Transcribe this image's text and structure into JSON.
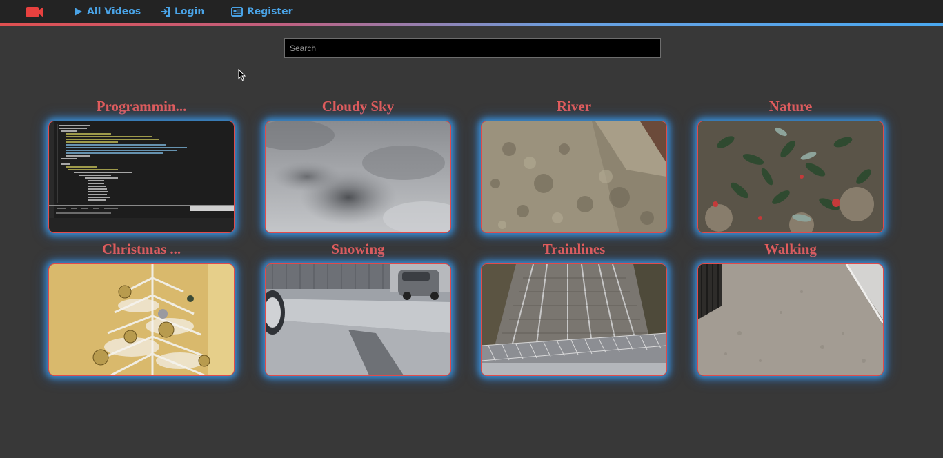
{
  "nav": {
    "logo_icon": "video-camera-icon",
    "links": [
      {
        "label": "All Videos",
        "icon": "play-icon"
      },
      {
        "label": "Login",
        "icon": "login-icon"
      },
      {
        "label": "Register",
        "icon": "id-card-icon"
      }
    ]
  },
  "search": {
    "placeholder": "Search",
    "value": ""
  },
  "videos": [
    {
      "title": "Programmin..."
    },
    {
      "title": "Cloudy Sky"
    },
    {
      "title": "River"
    },
    {
      "title": "Nature"
    },
    {
      "title": "Christmas ..."
    },
    {
      "title": "Snowing"
    },
    {
      "title": "Trainlines"
    },
    {
      "title": "Walking"
    }
  ],
  "colors": {
    "accent_red": "#e15c5c",
    "link_blue": "#4aa3e6",
    "glow_blue": "#3ca0f0",
    "background": "#383838",
    "navbar": "#232323"
  }
}
